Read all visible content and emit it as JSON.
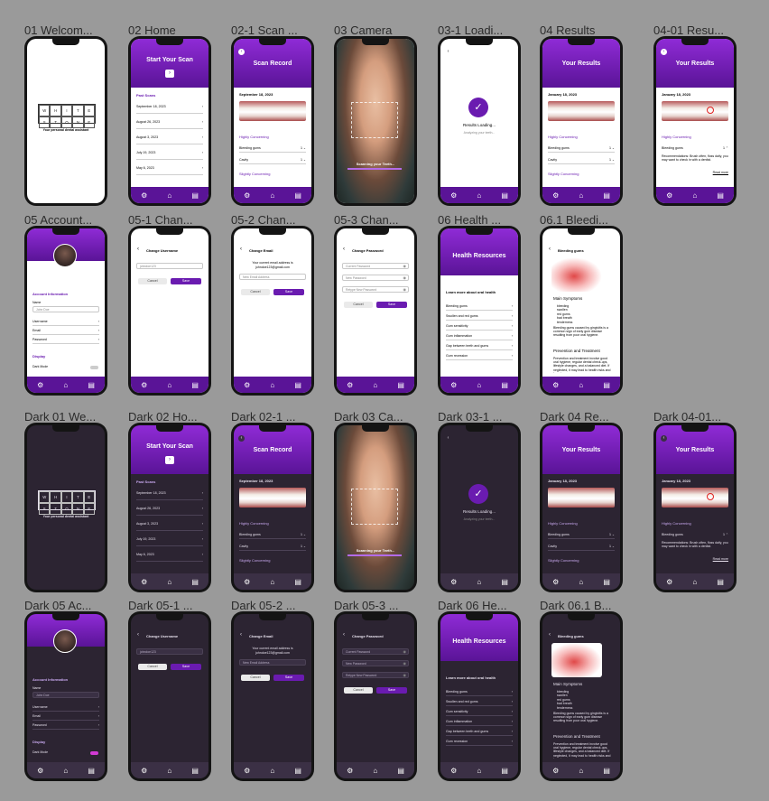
{
  "frames": [
    {
      "label": "01 Welcom...",
      "type": "welcome",
      "dark": false
    },
    {
      "label": "02 Home",
      "type": "home",
      "dark": false
    },
    {
      "label": "02-1 Scan ...",
      "type": "scan",
      "dark": false
    },
    {
      "label": "03 Camera",
      "type": "camera",
      "dark": false
    },
    {
      "label": "03-1 Loadi...",
      "type": "loading",
      "dark": false
    },
    {
      "label": "04 Results",
      "type": "results",
      "dark": false
    },
    {
      "label": "04-01 Resu...",
      "type": "results2",
      "dark": false
    },
    {
      "label": "05 Account...",
      "type": "account",
      "dark": false
    },
    {
      "label": "05-1 Chan...",
      "type": "username",
      "dark": false
    },
    {
      "label": "05-2 Chan...",
      "type": "email",
      "dark": false
    },
    {
      "label": "05-3 Chan...",
      "type": "password",
      "dark": false
    },
    {
      "label": "06 Health ...",
      "type": "health",
      "dark": false
    },
    {
      "label": "06.1 Bleedi...",
      "type": "bleeding",
      "dark": false
    },
    {
      "label": "Dark 01 We...",
      "type": "welcome",
      "dark": true
    },
    {
      "label": "Dark 02 Ho...",
      "type": "home",
      "dark": true
    },
    {
      "label": "Dark 02-1 ...",
      "type": "scan",
      "dark": true
    },
    {
      "label": "Dark 03 Ca...",
      "type": "camera",
      "dark": true
    },
    {
      "label": "Dark 03-1 ...",
      "type": "loading",
      "dark": true
    },
    {
      "label": "Dark 04 Re...",
      "type": "results",
      "dark": true
    },
    {
      "label": "Dark 04-01...",
      "type": "results2",
      "dark": true
    },
    {
      "label": "Dark 05 Ac...",
      "type": "account",
      "dark": true
    },
    {
      "label": "Dark 05-1 ...",
      "type": "username",
      "dark": true
    },
    {
      "label": "Dark 05-2 ...",
      "type": "email",
      "dark": true
    },
    {
      "label": "Dark 05-3 ...",
      "type": "password",
      "dark": true
    },
    {
      "label": "Dark 06 He...",
      "type": "health",
      "dark": true
    },
    {
      "label": "Dark 06.1 B...",
      "type": "bleeding",
      "dark": true
    }
  ],
  "app": {
    "logo_letters": [
      "W",
      "H",
      "I",
      "T",
      "E",
      "S",
      "T",
      "O",
      "N",
      "E"
    ],
    "tagline": "Your personal dental assistant",
    "tab_icons": [
      "gear-icon",
      "home-icon",
      "results-icon"
    ]
  },
  "home": {
    "title": "Start Your Scan",
    "past_scans": "Past Scans",
    "scans": [
      "September 18, 2023",
      "August 26, 2023",
      "August 3, 2023",
      "July 19, 2023",
      "May 6, 2023"
    ]
  },
  "scan": {
    "title": "Scan Record",
    "date": "September 18, 2023",
    "highly": "Highly Concerning",
    "items": [
      "Bleeding gums",
      "Cavity"
    ],
    "slightly": "Slightly Concerning"
  },
  "camera": {
    "status": "Scanning your Teeth..."
  },
  "loading": {
    "title": "Results Loading...",
    "sub": "Analyzing your teeth..."
  },
  "results": {
    "title": "Your Results",
    "date": "January 18, 2023",
    "highly": "Highly Concerning",
    "items": [
      "Bleeding gums",
      "Cavity"
    ],
    "slightly": "Slightly Concerning",
    "recommendation": "Recommendations: Brush often, floss daily, you may want to check in with a dentist.",
    "read_more": "Read more"
  },
  "account": {
    "section": "Account Information",
    "name_label": "Name",
    "name_value": "John Doe",
    "fields": [
      "Username",
      "Email",
      "Password"
    ],
    "display": "Display",
    "dark_mode": "Dark Mode"
  },
  "username": {
    "title": "Change Username",
    "value": "johndoe123",
    "cancel": "Cancel",
    "save": "Save"
  },
  "email": {
    "title": "Change Email",
    "current_prefix": "Your current email address is",
    "current": "johndoe123@gmail.com",
    "placeholder": "New Email Address",
    "cancel": "Cancel",
    "save": "Save"
  },
  "password": {
    "title": "Change Password",
    "fields": [
      "Current Password",
      "New Password",
      "Retype New Password"
    ],
    "cancel": "Cancel",
    "save": "Save"
  },
  "health": {
    "title": "Health Resources",
    "sub": "Learn more about oral health",
    "items": [
      "Bleeding gums",
      "Swollen and red gums",
      "Gum sensitivity",
      "Gum inflammation",
      "Gap between teeth and gums",
      "Gum recession"
    ]
  },
  "bleeding": {
    "title": "Bleeding gums",
    "symptoms": "Main Symptoms",
    "list": [
      "bleeding",
      "swollen",
      "red gums",
      "bad breath",
      "tenderness"
    ],
    "body": "Bleeding gums caused by gingivitis is a common sign of early gum disease resulting from poor oral hygiene.",
    "prevention": "Prevention and Treatment",
    "prevention_body": "Prevention and treatment involve good oral hygiene, regular dental check-ups, lifestyle changes, and a balanced diet. If neglected, it may lead to health risks and long-term"
  }
}
